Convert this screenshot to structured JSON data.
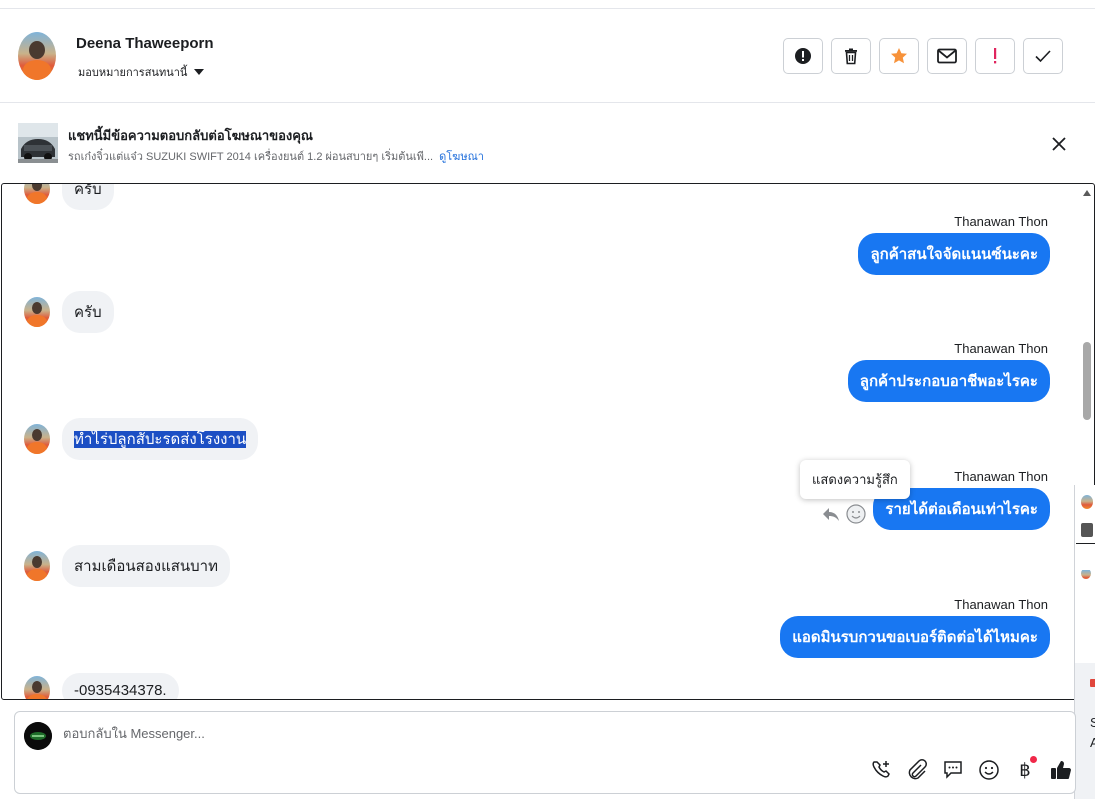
{
  "header": {
    "contact_name": "Deena Thaweeporn",
    "assign_label": "มอบหมายการสนทนานี้",
    "actions": [
      {
        "icon": "alert-circle-icon",
        "name": "mark-spam-button"
      },
      {
        "icon": "trash-icon",
        "name": "delete-button"
      },
      {
        "icon": "star-icon",
        "name": "star-button"
      },
      {
        "icon": "envelope-icon",
        "name": "mark-unread-button"
      },
      {
        "icon": "exclamation-icon",
        "name": "follow-up-button"
      },
      {
        "icon": "check-icon",
        "name": "mark-done-button"
      }
    ]
  },
  "ad_banner": {
    "title": "แชทนี้มีข้อความตอบกลับต่อโฆษณาของคุณ",
    "subtitle": "รถเก๋งจิ๋วแต่แจ๋ว SUZUKI SWIFT 2014 เครื่องยนต์ 1.2 ผ่อนสบายๆ เริ่มต้นเพี...",
    "link": "ดูโฆษณา"
  },
  "messages": [
    {
      "dir": "in",
      "text": "ครับ"
    },
    {
      "dir": "out",
      "sender": "Thanawan Thon",
      "text": "ลูกค้าสนใจจัดแนนซ์นะคะ"
    },
    {
      "dir": "in",
      "text": "ครับ"
    },
    {
      "dir": "out",
      "sender": "Thanawan Thon",
      "text": "ลูกค้าประกอบอาชีพอะไรคะ"
    },
    {
      "dir": "in",
      "text": "ทำไร่ปลูกสัปะรดส่งโรงงาน"
    },
    {
      "dir": "out",
      "sender": "Thanawan Thon",
      "text": "รายได้ต่อเดือนเท่าไรคะ"
    },
    {
      "dir": "in",
      "text": "สามเดือนสองแสนบาท"
    },
    {
      "dir": "out",
      "sender": "Thanawan Thon",
      "text": "แอดมินรบกวนขอเบอร์ติดต่อได้ไหมคะ"
    },
    {
      "dir": "in",
      "text": "-0935434378."
    }
  ],
  "tooltip": "แสดงความรู้สึก",
  "side_panel": {
    "letters": [
      "S",
      "A"
    ]
  },
  "composer": {
    "placeholder": "ตอบกลับใน Messenger...",
    "tools": [
      "phone-plus-icon",
      "paperclip-icon",
      "chat-bubble-icon",
      "emoji-icon",
      "baht-icon",
      "thumbs-up-icon"
    ]
  },
  "colors": {
    "accent": "#1877f2",
    "star": "#f7923a",
    "alert": "#e0245e",
    "bubble_in": "#f0f2f5"
  }
}
